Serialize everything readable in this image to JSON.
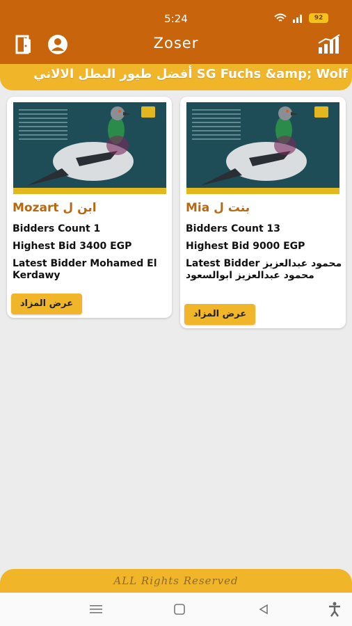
{
  "status_bar": {
    "time": "5:24",
    "battery": "92"
  },
  "app": {
    "title": "Zoser"
  },
  "banner": {
    "text": "أفضل طيور البطل الالاني SG Fuchs &amp; Wolf"
  },
  "auctions": [
    {
      "name": "Mozart ابن ل",
      "bidders_count": "Bidders Count 1",
      "highest_bid": "Highest Bid 3400 EGP",
      "latest_bidder": "Latest Bidder Mohamed El Kerdawy",
      "button_label": "عرض المزاد"
    },
    {
      "name": "Mia بنت ل",
      "bidders_count": "Bidders Count 13",
      "highest_bid": "Highest Bid 9000 EGP",
      "latest_bidder": "Latest Bidder محمود عبدالعزيز محمود عبدالعزيز ابوالسعود",
      "button_label": "عرض المزاد"
    }
  ],
  "footer": {
    "text": "ALL Rights Reserved"
  },
  "colors": {
    "appbar": "#c8650c",
    "accent": "#f1b52a",
    "name": "#b8680e"
  },
  "icons": {
    "logout": "door-exit-icon",
    "profile": "account-circle-icon",
    "stats": "chart-bars-icon",
    "nav_recent": "menu-lines-icon",
    "nav_home": "square-home-icon",
    "nav_back": "triangle-back-icon",
    "nav_accessibility": "accessibility-icon"
  }
}
